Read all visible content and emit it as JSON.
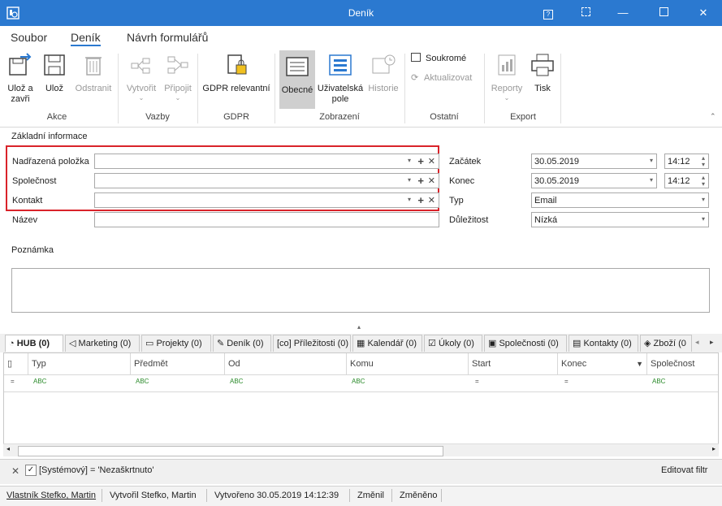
{
  "window": {
    "title": "Deník"
  },
  "menu": {
    "tabs": [
      "Soubor",
      "Deník",
      "Návrh formulářů"
    ]
  },
  "ribbon": {
    "buttons": {
      "save_close": "Ulož a zavři",
      "save": "Ulož",
      "delete": "Odstranit",
      "create": "Vytvořit",
      "attach": "Připojit",
      "gdpr": "GDPR relevantní",
      "general": "Obecné",
      "user_fields": "Uživatelská pole",
      "history": "Historie",
      "private": "Soukromé",
      "update": "Aktualizovat",
      "reports": "Reporty",
      "print": "Tisk"
    },
    "groups": [
      "Akce",
      "Vazby",
      "GDPR",
      "Zobrazení",
      "Ostatní",
      "Export"
    ]
  },
  "form": {
    "section_title": "Základní informace",
    "labels": {
      "parent": "Nadřazená položka",
      "company": "Společnost",
      "contact": "Kontakt",
      "name": "Název",
      "start": "Začátek",
      "end": "Konec",
      "type": "Typ",
      "importance": "Důležitost",
      "note": "Poznámka"
    },
    "values": {
      "start_date": "30.05.2019",
      "start_time": "14:12",
      "end_date": "30.05.2019",
      "end_time": "14:12",
      "type": "Email",
      "importance": "Nízká"
    }
  },
  "tabs": [
    "HUB (0)",
    "Marketing (0)",
    "Projekty (0)",
    "Deník (0)",
    "Příležitosti (0)",
    "Kalendář (0)",
    "Úkoly (0)",
    "Společnosti (0)",
    "Kontakty (0)",
    "Zboží (0"
  ],
  "grid": {
    "columns": [
      "Typ",
      "Předmět",
      "Od",
      "Komu",
      "Start",
      "Konec",
      "Společnost"
    ]
  },
  "filter": {
    "text": "[Systémový] = 'Nezaškrtnuto'",
    "edit_label": "Editovat filtr"
  },
  "status": {
    "owner": "Vlastník Stefko, Martin",
    "created_by": "Vytvořil Stefko, Martin",
    "created_on": "Vytvořeno 30.05.2019 14:12:39",
    "changed": "Změnil",
    "changed_on": "Změněno"
  },
  "colors": {
    "accent": "#2b79d0",
    "highlight": "#d9232a"
  }
}
